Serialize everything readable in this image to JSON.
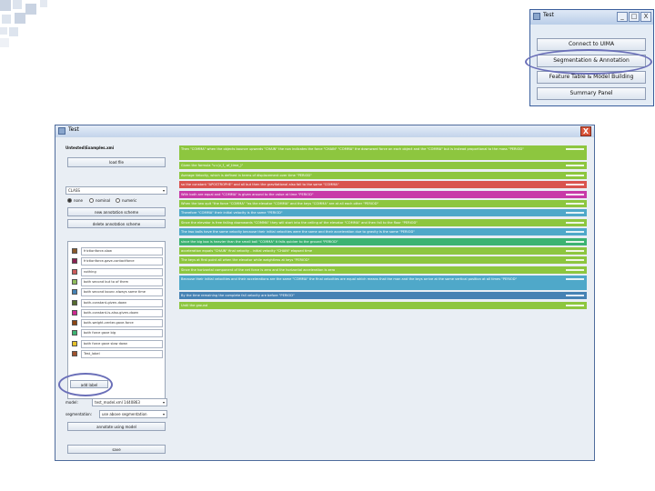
{
  "small_window": {
    "title": "Test",
    "buttons": [
      "Connect to UIMA",
      "Segmentation & Annotation",
      "Feature Table & Model Building",
      "Summary Panel"
    ],
    "window_controls": [
      "_",
      "□",
      "X"
    ]
  },
  "main_window": {
    "title": "Test",
    "close_label": "X",
    "file_path": "Untested\\Examples.xmi",
    "load_button": "load file",
    "scheme_select": "CLASS",
    "radio_options": [
      "none",
      "nominal",
      "numeric"
    ],
    "new_scheme_button": "new annotation scheme",
    "delete_scheme_button": "delete annotation scheme",
    "labels": [
      {
        "text": "frictionforce-slow",
        "color": "#8b5a2b"
      },
      {
        "text": "frictionforce-gave-contactforce",
        "color": "#8b2252"
      },
      {
        "text": "nothing",
        "color": "#cd5c5c"
      },
      {
        "text": "both second but to of them",
        "color": "#8fbc5b"
      },
      {
        "text": "both second bounc always same time",
        "color": "#4682b4"
      },
      {
        "text": "both-constant-given-down",
        "color": "#556b2f"
      },
      {
        "text": "both-constant-is-also-given-down",
        "color": "#cd2990"
      },
      {
        "text": "both-weight-center-gave-force",
        "color": "#8b4513"
      },
      {
        "text": "both force gave big",
        "color": "#3cb371"
      },
      {
        "text": "both force gave slow down",
        "color": "#e6c229"
      },
      {
        "text": "Test_label",
        "color": "#a0522d"
      }
    ],
    "add_label_button": "add label",
    "model_label": "model:",
    "model_value": "test_model.xml  1440863",
    "segmentation_label": "segmentation:",
    "segmentation_value": "use above segmentation",
    "annotate_button": "annotate using model",
    "save_button": "save",
    "segments": [
      {
        "text": "Then \"COMMA\" when the objects bounce upwards \"CHAIN\" the non indicates the force \"CHAIN\" \"COMMA\" the downward force on each object and the \"COMMA\" but is instead proportional to the mass \"PERIOD\"",
        "color": "#8dc63f",
        "tall": true
      },
      {
        "text": "Given the formula \"v=(v_f_ of_time_)\"",
        "color": "#8dc63f",
        "tall": false
      },
      {
        "text": "Average Velocity, which is defined in terms of displacement over time \"PERIOD\"",
        "color": "#8dc63f",
        "tall": false
      },
      {
        "text": "so the constant \"APOSTROPHE\" and all but then the gravitational also fall to the same \"COMMA\"",
        "color": "#d9534f",
        "tall": false
      },
      {
        "text": "With both are equal and \"COMMA\" is given around to the value at time \"PERIOD\"",
        "color": "#c83aa8",
        "tall": false
      },
      {
        "text": "When the two quit \"the force \"COMMA\" \"as the elevator \"COMMA\" and the keys \"COMMA\" are at all each other \"PERIOD\"",
        "color": "#8dc63f",
        "tall": false
      },
      {
        "text": "Therefore \"COMMA\" their initial velocity is the same \"PERIOD\"",
        "color": "#4fa8c9",
        "tall": false
      },
      {
        "text": "Since the elevator is free falling downwards \"COMMA\" they will start into the ceiling of the elevator \"COMMA\" and then fall to the floor \"PERIOD\"",
        "color": "#8dc63f",
        "tall": false
      },
      {
        "text": "The two balls have the same velocity because their initial velocities were the same and their acceleration due to gravity is the same \"PERIOD\"",
        "color": "#4fa8c9",
        "tall": false
      },
      {
        "text": "since the big box is heavier than the small ball \"COMMA\" it falls quicker to the ground \"PERIOD\"",
        "color": "#3cb371",
        "tall": false
      },
      {
        "text": "acceleration equals \"CHAIN\" final velocity - initial velocity \"CHAIN\" elapsed time",
        "color": "#8dc63f",
        "tall": false
      },
      {
        "text": "The keys at first point all when the elevator while weightless at keys \"PERIOD\"",
        "color": "#8dc63f",
        "tall": false
      },
      {
        "text": "Since the horizontal component of the net force is zero and the horizontal acceleration is zero",
        "color": "#8dc63f",
        "tall": false
      },
      {
        "text": "Because their initial velocities and their accelerations are the same \"COMMA\" the final velocities are equal which means that the man and the keys arrive at the same vertical position at all times \"PERIOD\"",
        "color": "#4fa8c9",
        "tall": true
      },
      {
        "text": "By the time remaining the complete fall velocity are before \"PERIOD\"",
        "color": "#4682b4",
        "tall": false
      },
      {
        "text": "Until the ground",
        "color": "#8dc63f",
        "tall": false
      }
    ]
  }
}
